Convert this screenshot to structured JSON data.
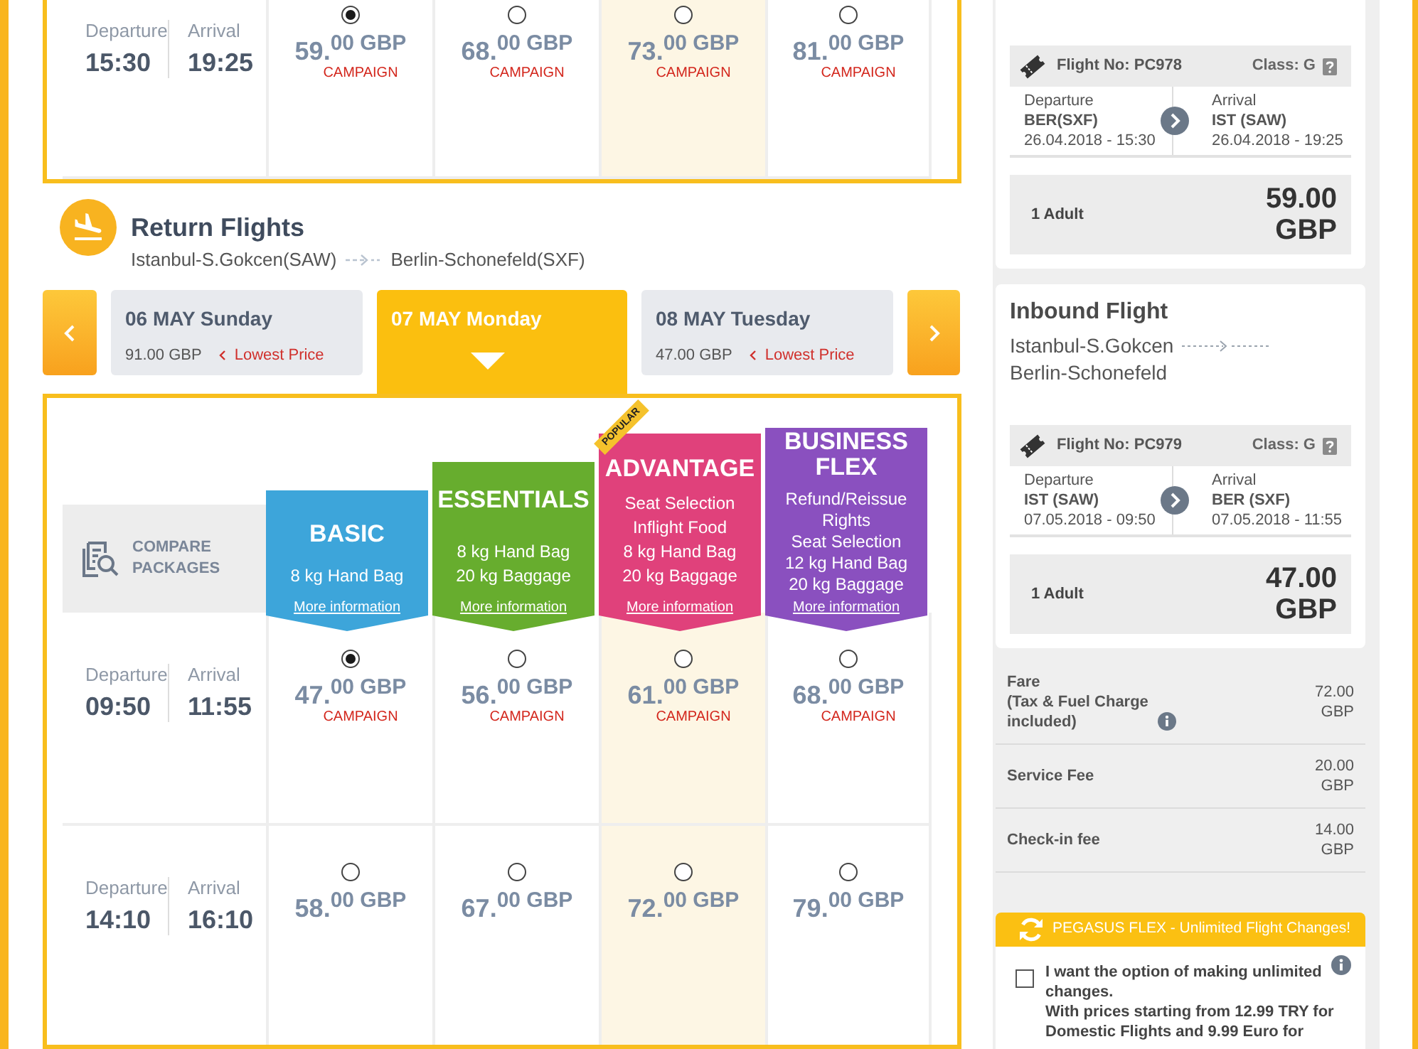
{
  "outbound_flights": {
    "rows": [
      {
        "departure_label": "Departure",
        "departure_time": "15:30",
        "arrival_label": "Arrival",
        "arrival_time": "19:25",
        "fares": [
          {
            "price": "59.$^{00 GBP}$",
            "tag": "CAMPAIGN",
            "selected": true,
            "highlighted": false
          },
          {
            "price": "68.$^{00 GBP}$",
            "tag": "CAMPAIGN",
            "selected": false,
            "highlighted": false
          },
          {
            "price": "73.$^{00 GBP}$",
            "tag": "CAMPAIGN",
            "selected": false,
            "highlighted": true
          },
          {
            "price": "81.$^{00 GBP}$",
            "tag": "CAMPAIGN",
            "selected": false,
            "highlighted": false
          }
        ]
      }
    ]
  },
  "return_flights": {
    "title": "Return Flights",
    "origin": "Istanbul-S.Gokcen(SAW)",
    "destination": "Berlin-Schonefeld(SXF)",
    "dates": [
      {
        "date": "06 MAY Sunday",
        "price": "91.00 GBP",
        "note": "Lowest Price",
        "selected": false
      },
      {
        "date": "07 MAY Monday",
        "selected": true
      },
      {
        "date": "08 MAY Tuesday",
        "price": "47.00 GBP",
        "note": "Lowest Price",
        "selected": false
      }
    ],
    "compare_label": "COMPARE PACKAGES",
    "packages": [
      {
        "name": "BASIC",
        "color": "#3da5da",
        "features": [
          "8 kg Hand Bag"
        ],
        "link": "More information"
      },
      {
        "name": "ESSENTIALS",
        "color": "#67ad2e",
        "features": [
          "8 kg Hand Bag",
          "20 kg Baggage"
        ],
        "link": "More information"
      },
      {
        "name": "ADVANTAGE",
        "color": "#e0417b",
        "badge": "POPULAR",
        "features": [
          "Seat Selection",
          "Inflight Food",
          "8 kg Hand Bag",
          "20 kg Baggage"
        ],
        "link": "More information"
      },
      {
        "name": "BUSINESS FLEX",
        "color": "#8a50bf",
        "features": [
          "Refund/Reissue Rights",
          "Seat Selection",
          "12 kg Hand Bag",
          "20 kg Baggage"
        ],
        "link": "More information"
      }
    ],
    "rows": [
      {
        "departure_label": "Departure",
        "departure_time": "09:50",
        "arrival_label": "Arrival",
        "arrival_time": "11:55",
        "fares": [
          {
            "price": "47.$^{00 GBP}$",
            "tag": "CAMPAIGN",
            "selected": true,
            "highlighted": false
          },
          {
            "price": "56.$^{00 GBP}$",
            "tag": "CAMPAIGN",
            "selected": false,
            "highlighted": false
          },
          {
            "price": "61.$^{00 GBP}$",
            "tag": "CAMPAIGN",
            "selected": false,
            "highlighted": true
          },
          {
            "price": "68.$^{00 GBP}$",
            "tag": "CAMPAIGN",
            "selected": false,
            "highlighted": false
          }
        ]
      },
      {
        "departure_label": "Departure",
        "departure_time": "14:10",
        "arrival_label": "Arrival",
        "arrival_time": "16:10",
        "fares": [
          {
            "price": "58.$^{00 GBP}$",
            "selected": false,
            "highlighted": false
          },
          {
            "price": "67.$^{00 GBP}$",
            "selected": false,
            "highlighted": false
          },
          {
            "price": "72.$^{00 GBP}$",
            "selected": false,
            "highlighted": true
          },
          {
            "price": "79.$^{00 GBP}$",
            "selected": false,
            "highlighted": false
          }
        ]
      }
    ]
  },
  "summary": {
    "outbound": {
      "flight_no": "Flight No: PC978",
      "class": "Class: G",
      "departure": {
        "label": "Departure",
        "airport": "BER(SXF)",
        "time": "26.04.2018 - 15:30"
      },
      "arrival": {
        "label": "Arrival",
        "airport": "IST (SAW)",
        "time": "26.04.2018 - 19:25"
      },
      "passengers": "1 Adult",
      "total": "59.00 GBP"
    },
    "inbound": {
      "title": "Inbound Flight",
      "origin": "Istanbul-S.Gokcen",
      "destination": "Berlin-Schonefeld",
      "flight_no": "Flight No: PC979",
      "class": "Class: G",
      "departure": {
        "label": "Departure",
        "airport": "IST (SAW)",
        "time": "07.05.2018 - 09:50"
      },
      "arrival": {
        "label": "Arrival",
        "airport": "BER (SXF)",
        "time": "07.05.2018 - 11:55"
      },
      "passengers": "1 Adult",
      "total": "47.00 GBP"
    },
    "charges": [
      {
        "label": "Fare",
        "note": "(Tax & Fuel Charge included)",
        "info": true,
        "amount": "72.00 GBP"
      },
      {
        "label": "Service Fee",
        "amount": "20.00 GBP"
      },
      {
        "label": "Check-in fee",
        "amount": "14.00 GBP"
      }
    ],
    "flex": {
      "title": "PEGASUS FLEX - Unlimited Flight Changes!",
      "checked": false,
      "option": "I want the option of making unlimited changes.",
      "details": "With prices starting from 12.99 TRY for Domestic Flights and 9.99 Euro for"
    }
  }
}
